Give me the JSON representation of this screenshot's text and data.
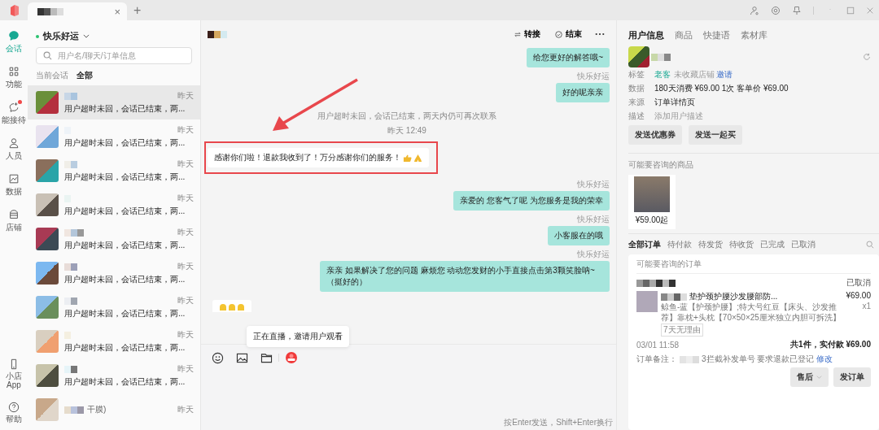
{
  "title_bar": {
    "tab_close": "×",
    "new_tab": "+"
  },
  "nav": [
    {
      "label": "会话",
      "selected": true,
      "dot": false
    },
    {
      "label": "功能",
      "selected": false,
      "dot": false
    },
    {
      "label": "能接待",
      "selected": false,
      "dot": true
    },
    {
      "label": "人员",
      "selected": false,
      "dot": false
    },
    {
      "label": "数据",
      "selected": false,
      "dot": false
    },
    {
      "label": "店铺",
      "selected": false,
      "dot": false
    }
  ],
  "nav_bottom": [
    {
      "label": "小店App"
    },
    {
      "label": "帮助"
    }
  ],
  "conversations": {
    "account": "快乐好运",
    "online": true,
    "search": {
      "placeholder": "用户名/聊天/订单信息"
    },
    "tabs": [
      {
        "label": "当前会话",
        "selected": false
      },
      {
        "label": "全部",
        "selected": true
      }
    ],
    "items": [
      {
        "time": "昨天",
        "preview": "用户超时未回，会话已结束，两...",
        "selected": true
      },
      {
        "time": "昨天",
        "preview": "用户超时未回，会话已结束，两...",
        "selected": false
      },
      {
        "time": "昨天",
        "preview": "用户超时未回，会话已结束，两...",
        "selected": false
      },
      {
        "time": "昨天",
        "preview": "用户超时未回，会话已结束，两...",
        "selected": false
      },
      {
        "time": "昨天",
        "preview": "用户超时未回，会话已结束，两...",
        "selected": false
      },
      {
        "time": "昨天",
        "preview": "用户超时未回，会话已结束，两...",
        "selected": false
      },
      {
        "time": "昨天",
        "preview": "用户超时未回，会话已结束，两...",
        "selected": false
      },
      {
        "time": "昨天",
        "preview": "用户超时未回，会话已结束，两...",
        "selected": false
      },
      {
        "time": "昨天",
        "preview": "用户超时未回，会话已结束，两...",
        "selected": false
      },
      {
        "time": "昨天",
        "name_tail": "干膜)",
        "selected": false
      }
    ]
  },
  "chat": {
    "actions": [
      {
        "label": "转接"
      },
      {
        "label": "结束"
      }
    ],
    "messages": [
      {
        "kind": "outgoing",
        "text": "给您更好的解答哦~",
        "highlighted": false
      },
      {
        "kind": "outgoing",
        "sender": "快乐好运",
        "text": "好的呢亲亲",
        "highlighted": false
      },
      {
        "kind": "system",
        "text": "用户超时未回，会话已结束，两天内仍可再次联系",
        "highlighted": false
      },
      {
        "kind": "time",
        "text": "昨天 12:49",
        "highlighted": false
      },
      {
        "kind": "incoming",
        "text": "感谢你们啦！退款我收到了！万分感谢你们的服务！",
        "highlighted": true
      },
      {
        "kind": "outgoing",
        "sender": "快乐好运",
        "text": "亲爱的  您客气了呢   为您服务是我的荣幸",
        "highlighted": false
      },
      {
        "kind": "outgoing",
        "sender": "快乐好运",
        "text": "小客服在的哦",
        "highlighted": false
      },
      {
        "kind": "outgoing",
        "sender": "快乐好运",
        "text": "亲亲 如果解决了您的问题 麻烦您 动动您发财的小手直接点击第3颗笑脸呐~（挺好的）",
        "highlighted": false
      },
      {
        "kind": "emoji",
        "highlighted": false
      }
    ],
    "tooltip": "正在直播，邀请用户观看",
    "hint": "按Enter发送，Shift+Enter换行"
  },
  "right": {
    "tabs": [
      {
        "label": "用户信息",
        "selected": true
      },
      {
        "label": "商品",
        "selected": false
      },
      {
        "label": "快捷语",
        "selected": false
      },
      {
        "label": "素材库",
        "selected": false
      }
    ],
    "profile": {
      "rows": [
        {
          "label": "标签",
          "kind": "tags",
          "tags": [
            {
              "text": "老客",
              "kind": "primary"
            },
            {
              "text": "未收藏店铺",
              "kind": "muted"
            },
            {
              "text": "邀请",
              "kind": "link"
            }
          ]
        },
        {
          "label": "数据",
          "kind": "text",
          "value": "180天消费 ¥69.00  1次   客单价 ¥69.00"
        },
        {
          "label": "来源",
          "kind": "text",
          "value": "订单详情页"
        },
        {
          "label": "描述",
          "kind": "placeholder",
          "placeholder": "添加用户描述"
        }
      ],
      "buttons": [
        "发送优惠券",
        "发送一起买"
      ]
    },
    "products": {
      "title": "可能要咨询的商品",
      "items": [
        {
          "price": "¥59.00起"
        }
      ]
    },
    "orders": {
      "tabs": [
        {
          "label": "全部订单",
          "selected": true
        },
        {
          "label": "待付款",
          "selected": false
        },
        {
          "label": "待发货",
          "selected": false
        },
        {
          "label": "待收货",
          "selected": false
        },
        {
          "label": "已完成",
          "selected": false
        },
        {
          "label": "已取消",
          "selected": false
        }
      ],
      "card": {
        "title": "可能要咨询的订单",
        "status": "已取消",
        "product": "垫护颈护腰沙发腰部防...",
        "price": "¥69.00",
        "qty": "x1",
        "spec": "鲸鱼-蓝【护颈护腰】;特大号红豆【床头、沙发推荐】靠枕+头枕【70×50×25厘米独立内胆可拆洗】",
        "tag": "7天无理由",
        "time": "03/01 11:58",
        "total": "共1件，实付款 ¥69.00",
        "note_label": "订单备注：",
        "note": "3拦截补发单号 要求退款已登记",
        "note_link": "修改",
        "buttons": [
          {
            "label": "售后",
            "dropdown": true
          },
          {
            "label": "发订单",
            "dropdown": false
          }
        ]
      }
    }
  }
}
